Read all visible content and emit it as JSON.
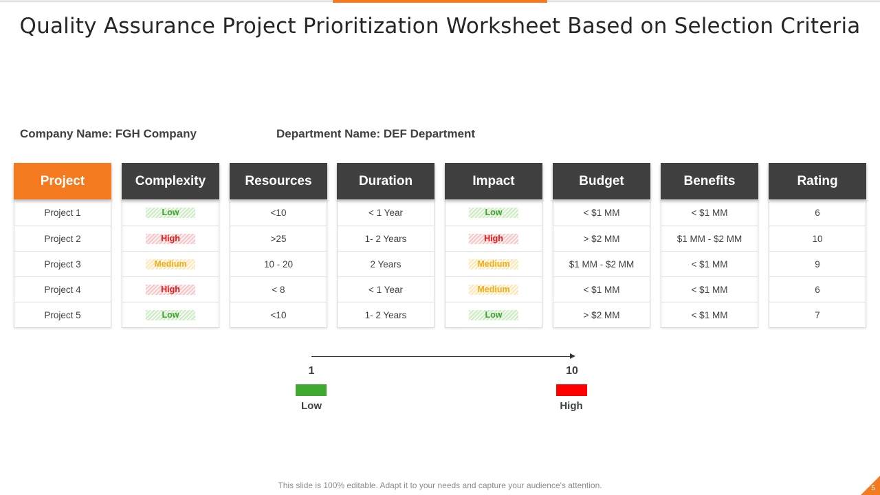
{
  "title": "Quality Assurance Project Prioritization Worksheet Based on Selection Criteria",
  "company": "Company Name: FGH Company",
  "department": "Department Name: DEF Department",
  "colors": {
    "accent": "#f47a1f",
    "header_dark": "#404040",
    "low": "#3fa130",
    "medium": "#f0ae1a",
    "high": "#e01a1a",
    "scale_low": "#3fa930",
    "scale_high": "#ff0000"
  },
  "table": {
    "headers": [
      "Project",
      "Complexity",
      "Resources",
      "Duration",
      "Impact",
      "Budget",
      "Benefits",
      "Rating"
    ],
    "rows": [
      [
        "Project 1",
        "Low",
        "<10",
        "< 1 Year",
        "Low",
        "< $1 MM",
        "< $1 MM",
        "6"
      ],
      [
        "Project 2",
        "High",
        ">25",
        "1- 2 Years",
        "High",
        "> $2 MM",
        "$1 MM - $2 MM",
        "10"
      ],
      [
        "Project 3",
        "Medium",
        "10 - 20",
        "2 Years",
        "Medium",
        "$1 MM - $2 MM",
        "< $1 MM",
        "9"
      ],
      [
        "Project 4",
        "High",
        "< 8",
        "< 1 Year",
        "Medium",
        "< $1 MM",
        "< $1 MM",
        "6"
      ],
      [
        "Project 5",
        "Low",
        "<10",
        "1- 2 Years",
        "Low",
        "> $2 MM",
        "< $1 MM",
        "7"
      ]
    ]
  },
  "scale": {
    "min_value": "1",
    "max_value": "10",
    "min_label": "Low",
    "max_label": "High"
  },
  "footer": "This slide is 100% editable. Adapt it to your needs and capture your audience's attention.",
  "page_number": "5"
}
